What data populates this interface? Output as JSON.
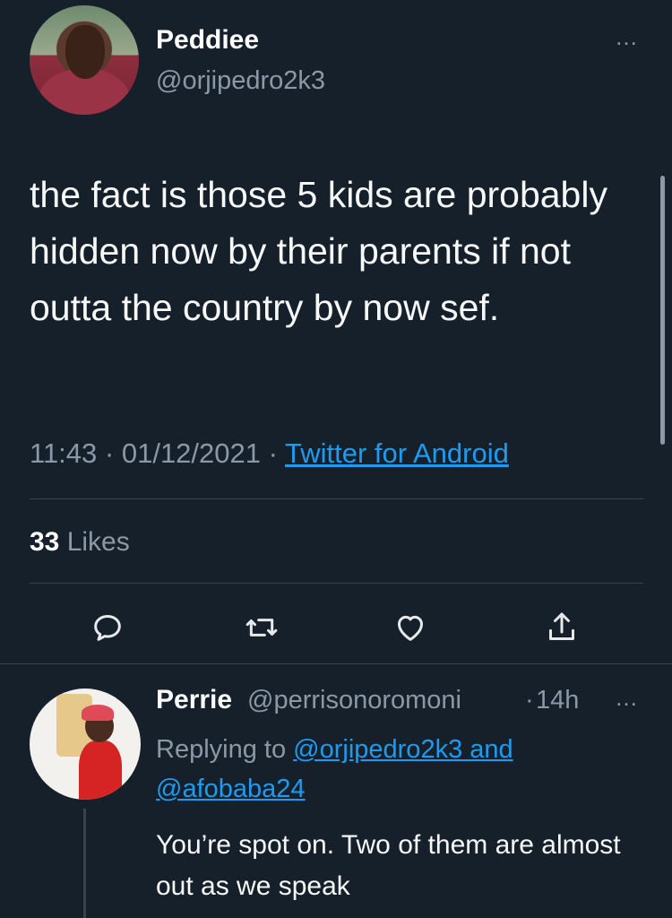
{
  "tweet": {
    "author_name": "Peddiee",
    "author_handle": "@orjipedro2k3",
    "more_icon": "…",
    "text": "the fact is those 5 kids are probably hidden now by their parents if not outta the country by now sef.",
    "time": "11:43",
    "dot1": " · ",
    "date": "01/12/2021",
    "dot2": " · ",
    "source": "Twitter for Android",
    "likes_count": "33",
    "likes_label": " Likes"
  },
  "actions": [
    {
      "name": "reply-icon"
    },
    {
      "name": "retweet-icon"
    },
    {
      "name": "like-icon"
    },
    {
      "name": "share-icon"
    }
  ],
  "reply": {
    "author_name": "Perrie",
    "author_handle": "@perrisonoromoni",
    "dot": "·",
    "time": "14h",
    "more_icon": "…",
    "replying_prefix": "Replying to ",
    "replying_to_1": "@orjipedro2k3 and",
    "replying_to_2": "@afobaba24",
    "text": "You’re spot on. Two of them are almost out as we speak"
  },
  "colors": {
    "background": "#15202b",
    "text": "#e7e9ea",
    "muted": "#8b98a5",
    "link": "#1d9bf0",
    "divider": "#38444d"
  }
}
